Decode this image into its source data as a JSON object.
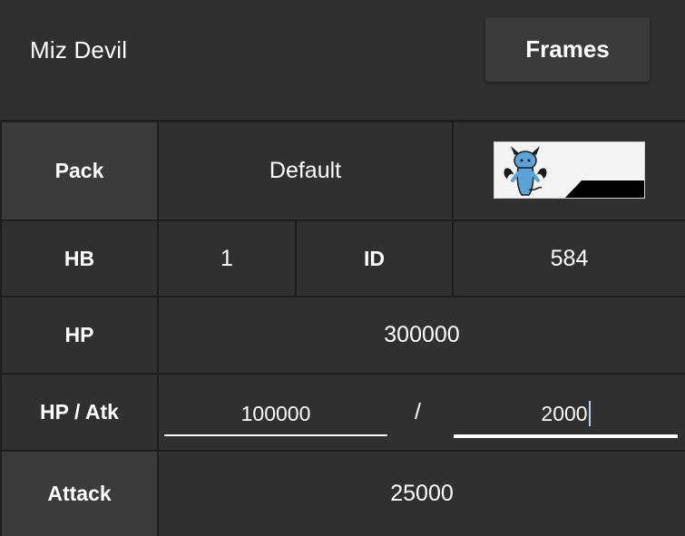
{
  "header": {
    "title": "Miz Devil",
    "frames_button": "Frames"
  },
  "rows": {
    "pack": {
      "label": "Pack",
      "value": "Default",
      "icon": "miz-devil-sprite-icon"
    },
    "hb": {
      "label": "HB",
      "value": "1",
      "id_label": "ID",
      "id_value": "584"
    },
    "hp": {
      "label": "HP",
      "value": "300000"
    },
    "hp_atk": {
      "label": "HP / Atk",
      "hp_value": "100000",
      "separator": "/",
      "atk_value": "2000"
    },
    "attack": {
      "label": "Attack",
      "value": "25000"
    }
  },
  "colors": {
    "background": "#303030",
    "grid_line": "#1e1e1e",
    "button": "#3b3b3b",
    "sprite_blue": "#5aa2d8"
  }
}
